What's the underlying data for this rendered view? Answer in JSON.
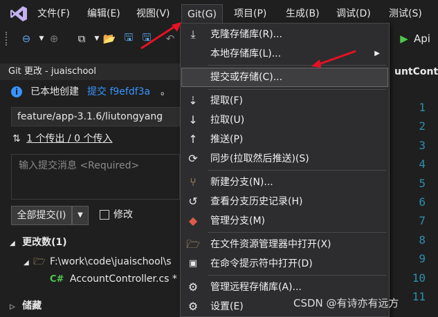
{
  "menubar": {
    "items": [
      "文件(F)",
      "编辑(E)",
      "视图(V)",
      "Git(G)",
      "项目(P)",
      "生成(B)",
      "调试(D)",
      "测试(S)"
    ]
  },
  "toolbar": {
    "run_label": "Api"
  },
  "git_pane": {
    "title": "Git 更改 - juaischool",
    "info_text": "已本地创建",
    "info_link": "提交 f9efdf3a",
    "info_suffix": "。",
    "branch": "feature/app-3.1.6/liutongyang",
    "sync_text": "1 个传出 / 0 个传入",
    "message_placeholder": "输入提交消息 <Required>",
    "commit_all_label": "全部提交(I)",
    "amend_label": "修改",
    "changes_header": "更改数(1)",
    "folder_path": "F:\\work\\code\\juaischool\\s",
    "file_name": "AccountController.cs *",
    "file_lang": "C#",
    "stash_header": "储藏"
  },
  "editor": {
    "tab_title": "untControl",
    "line_numbers": [
      "1",
      "2",
      "3",
      "4",
      "5",
      "6",
      "7",
      "8",
      "9",
      "10",
      "11"
    ]
  },
  "git_menu": {
    "items": [
      {
        "label": "克隆存储库(R)...",
        "icon": "clone-icon"
      },
      {
        "label": "本地存储库(L)...",
        "icon": "none",
        "submenu": true
      },
      {
        "label": "提交或存储(C)...",
        "icon": "none",
        "highlighted": true
      },
      {
        "label": "提取(F)",
        "icon": "fetch-icon"
      },
      {
        "label": "拉取(U)",
        "icon": "pull-icon"
      },
      {
        "label": "推送(P)",
        "icon": "push-icon"
      },
      {
        "label": "同步(拉取然后推送)(S)",
        "icon": "sync-icon"
      },
      {
        "label": "新建分支(N)...",
        "icon": "new-branch-icon"
      },
      {
        "label": "查看分支历史记录(H)",
        "icon": "history-icon"
      },
      {
        "label": "管理分支(M)",
        "icon": "manage-branches-icon"
      },
      {
        "label": "在文件资源管理器中打开(X)",
        "icon": "folder-open-icon"
      },
      {
        "label": "在命令提示符中打开(D)",
        "icon": "terminal-icon"
      },
      {
        "label": "管理远程存储库(A)...",
        "icon": "gear-icon"
      },
      {
        "label": "设置(E)",
        "icon": "gear-icon"
      }
    ]
  },
  "watermark": "CSDN @有诗亦有远方",
  "colors": {
    "background": "#1f1f1f",
    "menu_bg": "#2d2d30",
    "accent_blue": "#3794ff",
    "line_number": "#2b91af",
    "annotation_red": "#e81123"
  }
}
